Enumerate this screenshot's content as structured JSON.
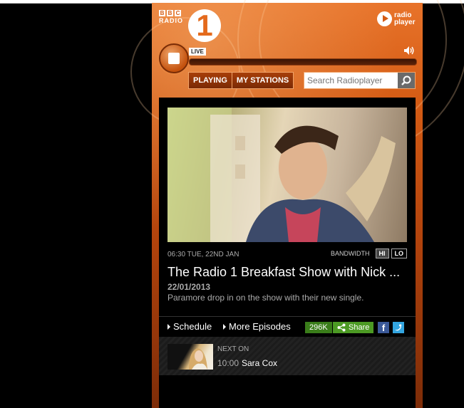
{
  "brand": {
    "bbc_letters": [
      "B",
      "B",
      "C"
    ],
    "radio_word": "RADIO",
    "station_number": "1",
    "radioplayer_line1": "radio",
    "radioplayer_line2": "player"
  },
  "player": {
    "live_badge": "LIVE",
    "stop_icon": "stop-icon",
    "volume_icon": "speaker-icon"
  },
  "nav": {
    "playing": "PLAYING",
    "my_stations": "MY STATIONS"
  },
  "search": {
    "placeholder": "Search Radioplayer",
    "value": "",
    "icon": "magnifier-icon"
  },
  "episode": {
    "broadcast_time": "06:30 TUE, 22ND JAN",
    "bandwidth_label": "BANDWIDTH",
    "bandwidth_hi": "HI",
    "bandwidth_lo": "LO",
    "title": "The Radio 1 Breakfast Show with Nick ...",
    "date": "22/01/2013",
    "description": "Paramore drop in on the show with their new single."
  },
  "links": {
    "schedule": "Schedule",
    "more_episodes": "More Episodes",
    "share_count": "296K",
    "share": "Share",
    "facebook_icon": "facebook-icon",
    "twitter_icon": "twitter-icon"
  },
  "next_on": {
    "label": "NEXT ON",
    "time": "10:00",
    "presenter": "Sara Cox"
  },
  "colors": {
    "brand_orange": "#e46a1c",
    "share_green": "#4c9a24",
    "facebook_blue": "#3b5998",
    "twitter_blue": "#33a5e0"
  }
}
